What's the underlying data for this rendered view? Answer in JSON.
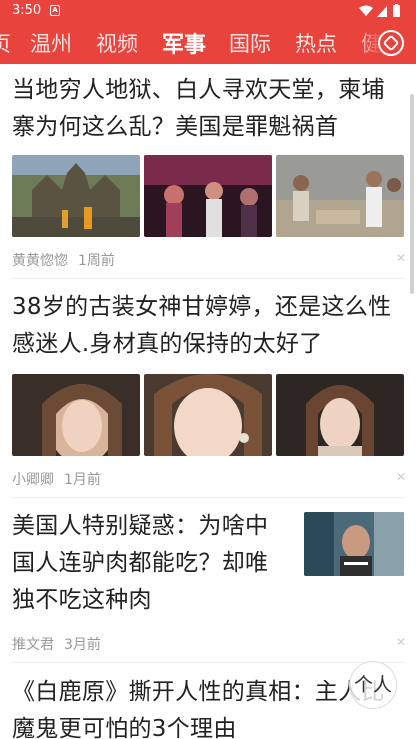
{
  "status_bar": {
    "time": "3:50",
    "notif_letter": "A"
  },
  "tabs": [
    {
      "label": "页"
    },
    {
      "label": "温州"
    },
    {
      "label": "视频"
    },
    {
      "label": "军事"
    },
    {
      "label": "国际"
    },
    {
      "label": "热点"
    },
    {
      "label": "健"
    }
  ],
  "active_tab_index": 3,
  "feed": [
    {
      "title": "当地穷人地狱、白人寻欢天堂，柬埔寨为何这么乱？美国是罪魁祸首",
      "author": "黄黄惚惚",
      "time": "1周前",
      "image_count": 3
    },
    {
      "title": "38岁的古装女神甘婷婷，还是这么性感迷人.身材真的保持的太好了",
      "author": "小卿卿",
      "time": "1月前",
      "image_count": 3
    },
    {
      "title": "美国人特别疑惑：为啥中国人连驴肉都能吃？却唯独不吃这种肉",
      "author": "推文君",
      "time": "3月前",
      "image_count": 1
    },
    {
      "title": "《白鹿原》撕开人性的真相：主人比魔鬼更可怕的3个理由",
      "author": "",
      "time": "",
      "image_count": 0
    }
  ],
  "back_to_top_label": "个人",
  "colors": {
    "brand": "#e8433d",
    "text": "#222222",
    "meta": "#999999"
  }
}
